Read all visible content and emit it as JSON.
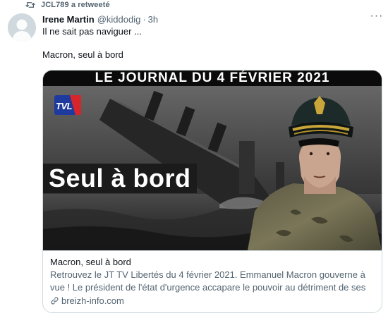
{
  "retweet": {
    "text": "JCL789 a retweeté",
    "icon": "retweet-icon"
  },
  "tweet": {
    "display_name": "Irene Martin",
    "handle": "@kiddodig",
    "separator": "·",
    "time": "3h",
    "text_line1": "Il ne sait pas naviguer ...",
    "text_line2": "Macron, seul à bord",
    "more_icon": "more-options-icon",
    "more_label": "···"
  },
  "card": {
    "media": {
      "banner": "LE JOURNAL DU 4 FÉVRIER 2021",
      "logo": "TVL",
      "headline": "Seul à bord"
    },
    "title": "Macron, seul à bord",
    "description": "Retrouvez le JT TV Libertés du 4 février 2021. Emmanuel Macron gouverne à vue ! Le président de l'état d'urgence accapare le pouvoir au détriment de ses",
    "domain": "breizh-info.com",
    "domain_icon": "link-icon"
  },
  "colors": {
    "text_primary": "#0f1419",
    "text_secondary": "#536471",
    "border": "#cfd9de",
    "logo_blue": "#1f3a9e",
    "logo_red": "#d6262c"
  }
}
